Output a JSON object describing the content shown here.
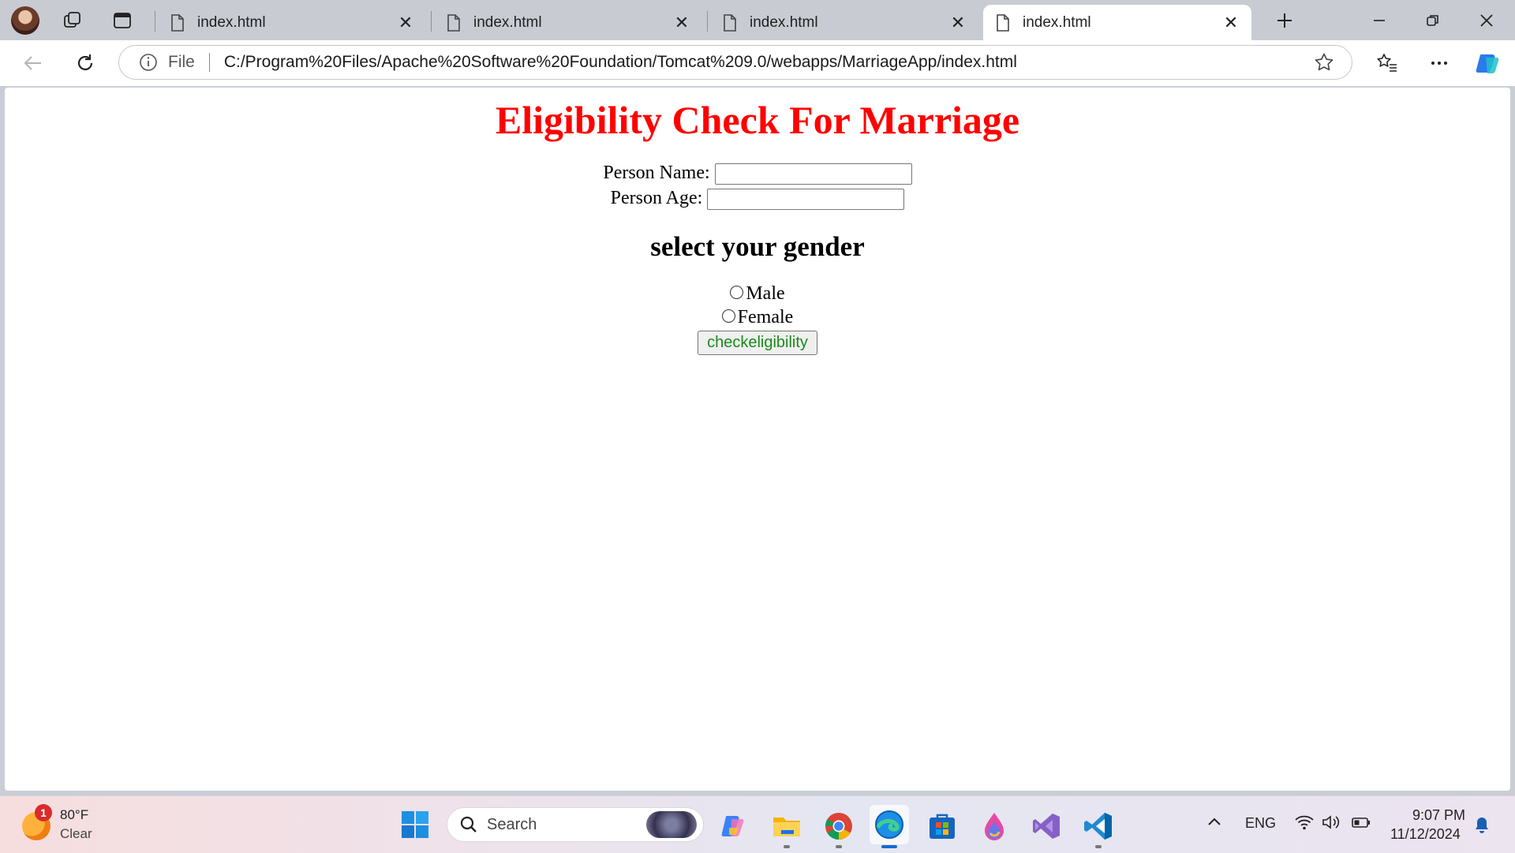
{
  "browser": {
    "tabs": [
      {
        "title": "index.html",
        "active": false
      },
      {
        "title": "index.html",
        "active": false
      },
      {
        "title": "index.html",
        "active": false
      },
      {
        "title": "index.html",
        "active": true
      }
    ],
    "address": {
      "scheme_label": "File",
      "url": "C:/Program%20Files/Apache%20Software%20Foundation/Tomcat%209.0/webapps/MarriageApp/index.html"
    }
  },
  "page": {
    "title": "Eligibility Check For Marriage",
    "title_color": "#ff0000",
    "name_label": "Person Name:",
    "name_value": "",
    "age_label": "Person Age:",
    "age_value": "",
    "gender_heading": "select your gender",
    "gender_options": [
      "Male",
      "Female"
    ],
    "submit_label": "checkeligibility",
    "submit_text_color": "#1a8a1a"
  },
  "taskbar": {
    "weather": {
      "temp": "80°F",
      "condition": "Clear",
      "badge": "1"
    },
    "search_placeholder": "Search",
    "apps": [
      "copilot-icon",
      "file-explorer-icon",
      "chrome-icon",
      "edge-icon",
      "store-icon",
      "paint-icon",
      "visual-studio-icon",
      "vscode-icon"
    ],
    "language": "ENG",
    "time": "9:07 PM",
    "date": "11/12/2024"
  }
}
